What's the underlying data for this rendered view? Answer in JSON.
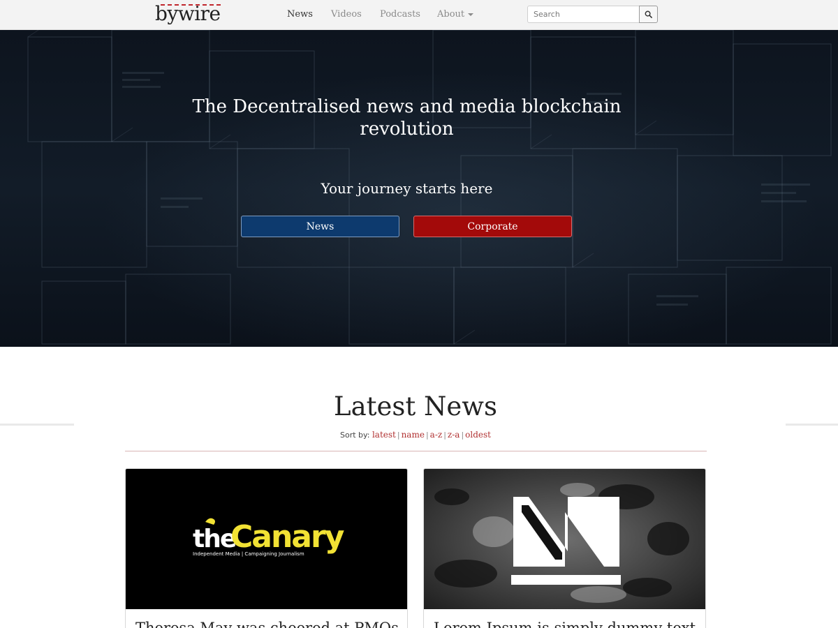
{
  "navbar": {
    "logo_text": "bywire",
    "links": [
      {
        "label": "News",
        "active": true
      },
      {
        "label": "Videos",
        "active": false
      },
      {
        "label": "Podcasts",
        "active": false
      },
      {
        "label": "About",
        "active": false,
        "dropdown": true
      }
    ],
    "search": {
      "placeholder": "Search",
      "value": "",
      "icon": "search-icon"
    }
  },
  "hero": {
    "title": "The Decentralised news and media blockchain revolution",
    "subtitle": "Your journey starts here",
    "buttons": [
      {
        "label": "News",
        "color": "#0d3a6e"
      },
      {
        "label": "Corporate",
        "color": "#a30a0a"
      }
    ]
  },
  "latest": {
    "title": "Latest News",
    "sort_label": "Sort by:",
    "sort_options": [
      "latest",
      "name",
      "a-z",
      "z-a",
      "oldest"
    ]
  },
  "cards": [
    {
      "logo_word1": "the",
      "logo_word2": "Canary",
      "logo_tagline": "Independent Media | Campaigning Journalism",
      "title": "Theresa May was cheered at PMQs..."
    },
    {
      "logo_letters": "N",
      "title": "Lorem Ipsum is simply dummy text..."
    }
  ],
  "colors": {
    "accent_red": "#b03030",
    "canary_yellow": "#f2e234",
    "hero_dark": "#121c28"
  }
}
